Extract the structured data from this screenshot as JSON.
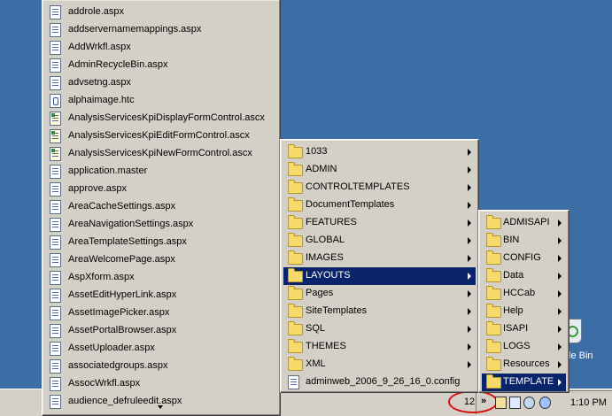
{
  "file_menu": {
    "items": [
      {
        "label": "addrole.aspx",
        "icon": "aspx-file-icon"
      },
      {
        "label": "addservernamemappings.aspx",
        "icon": "aspx-file-icon"
      },
      {
        "label": "AddWrkfl.aspx",
        "icon": "aspx-file-icon"
      },
      {
        "label": "AdminRecycleBin.aspx",
        "icon": "aspx-file-icon"
      },
      {
        "label": "advsetng.aspx",
        "icon": "aspx-file-icon"
      },
      {
        "label": "alphaimage.htc",
        "icon": "htc-file-icon"
      },
      {
        "label": "AnalysisServicesKpiDisplayFormControl.ascx",
        "icon": "ascx-file-icon"
      },
      {
        "label": "AnalysisServicesKpiEditFormControl.ascx",
        "icon": "ascx-file-icon"
      },
      {
        "label": "AnalysisServicesKpiNewFormControl.ascx",
        "icon": "ascx-file-icon"
      },
      {
        "label": "application.master",
        "icon": "aspx-file-icon"
      },
      {
        "label": "approve.aspx",
        "icon": "aspx-file-icon"
      },
      {
        "label": "AreaCacheSettings.aspx",
        "icon": "aspx-file-icon"
      },
      {
        "label": "AreaNavigationSettings.aspx",
        "icon": "aspx-file-icon"
      },
      {
        "label": "AreaTemplateSettings.aspx",
        "icon": "aspx-file-icon"
      },
      {
        "label": "AreaWelcomePage.aspx",
        "icon": "aspx-file-icon"
      },
      {
        "label": "AspXform.aspx",
        "icon": "aspx-file-icon"
      },
      {
        "label": "AssetEditHyperLink.aspx",
        "icon": "aspx-file-icon"
      },
      {
        "label": "AssetImagePicker.aspx",
        "icon": "aspx-file-icon"
      },
      {
        "label": "AssetPortalBrowser.aspx",
        "icon": "aspx-file-icon"
      },
      {
        "label": "AssetUploader.aspx",
        "icon": "aspx-file-icon"
      },
      {
        "label": "associatedgroups.aspx",
        "icon": "aspx-file-icon"
      },
      {
        "label": "AssocWrkfl.aspx",
        "icon": "aspx-file-icon"
      },
      {
        "label": "audience_defruleedit.aspx",
        "icon": "aspx-file-icon"
      }
    ]
  },
  "template_menu": {
    "items": [
      {
        "label": "1033",
        "type": "folder",
        "submenu": true
      },
      {
        "label": "ADMIN",
        "type": "folder",
        "submenu": true
      },
      {
        "label": "CONTROLTEMPLATES",
        "type": "folder",
        "submenu": true
      },
      {
        "label": "DocumentTemplates",
        "type": "folder",
        "submenu": true
      },
      {
        "label": "FEATURES",
        "type": "folder",
        "submenu": true
      },
      {
        "label": "GLOBAL",
        "type": "folder",
        "submenu": true
      },
      {
        "label": "IMAGES",
        "type": "folder",
        "submenu": true
      },
      {
        "label": "LAYOUTS",
        "type": "folder",
        "submenu": true,
        "selected": true
      },
      {
        "label": "Pages",
        "type": "folder",
        "submenu": true
      },
      {
        "label": "SiteTemplates",
        "type": "folder",
        "submenu": true
      },
      {
        "label": "SQL",
        "type": "folder",
        "submenu": true
      },
      {
        "label": "THEMES",
        "type": "folder",
        "submenu": true
      },
      {
        "label": "XML",
        "type": "folder",
        "submenu": true
      },
      {
        "label": "adminweb_2006_9_26_16_0.config",
        "type": "file",
        "submenu": false
      }
    ]
  },
  "root_menu": {
    "items": [
      {
        "label": "ADMISAPI",
        "submenu": true
      },
      {
        "label": "BIN",
        "submenu": true
      },
      {
        "label": "CONFIG",
        "submenu": true
      },
      {
        "label": "Data",
        "submenu": true
      },
      {
        "label": "HCCab",
        "submenu": true
      },
      {
        "label": "Help",
        "submenu": true
      },
      {
        "label": "ISAPI",
        "submenu": true
      },
      {
        "label": "LOGS",
        "submenu": true
      },
      {
        "label": "Resources",
        "submenu": true
      },
      {
        "label": "TEMPLATE",
        "submenu": true,
        "selected": true
      }
    ]
  },
  "taskbar": {
    "hidden_count": "12",
    "chevron": "»",
    "clock": "1:10 PM"
  },
  "desktop": {
    "recycle_bin_label": "le Bin"
  },
  "colors": {
    "desktop": "#3a6ea5",
    "menu": "#d4d0c8",
    "selection": "#0a246a",
    "annotation": "#d81010"
  }
}
